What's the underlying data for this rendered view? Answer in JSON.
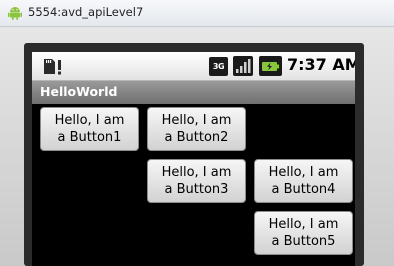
{
  "window": {
    "title": "5554:avd_apiLevel7"
  },
  "statusbar": {
    "network_label": "3G",
    "time": "7:37 AM"
  },
  "app": {
    "title": "HelloWorld"
  },
  "buttons": [
    {
      "line1": "Hello, I am",
      "line2": "a Button1"
    },
    {
      "line1": "Hello, I am",
      "line2": "a Button2"
    },
    {
      "line1": "Hello, I am",
      "line2": "a Button3"
    },
    {
      "line1": "Hello, I am",
      "line2": "a Button4"
    },
    {
      "line1": "Hello, I am",
      "line2": "a Button5"
    }
  ],
  "colors": {
    "android_green": "#8bc53f",
    "title_bar": "#7a7a7a",
    "screen_bg": "#000000"
  },
  "icons": [
    "android-icon",
    "sd-card-notification-icon",
    "signal-strength-icon",
    "battery-charging-icon"
  ]
}
